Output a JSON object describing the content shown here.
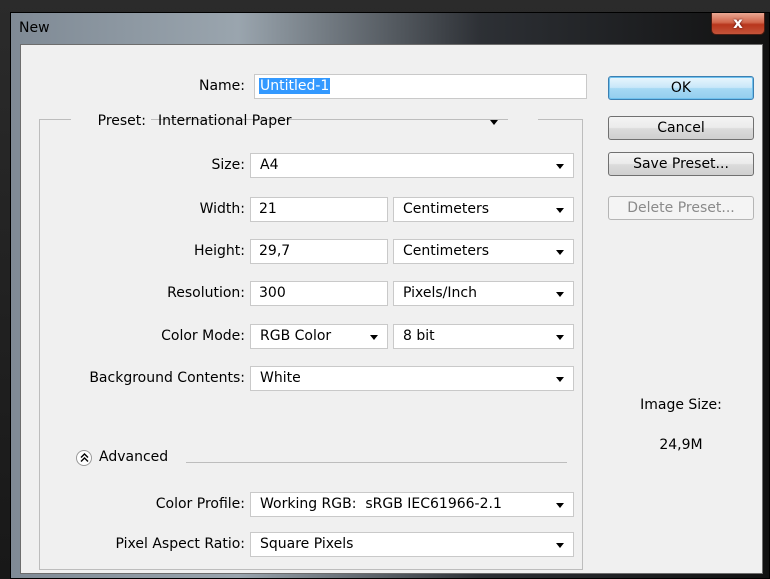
{
  "window": {
    "title": "New",
    "close_glyph": "x"
  },
  "form": {
    "name": {
      "label": "Name:",
      "value": "Untitled-1"
    },
    "preset": {
      "label": "Preset:",
      "value": "International Paper"
    },
    "size": {
      "label": "Size:",
      "value": "A4"
    },
    "width": {
      "label": "Width:",
      "value": "21",
      "unit": "Centimeters"
    },
    "height": {
      "label": "Height:",
      "value": "29,7",
      "unit": "Centimeters"
    },
    "resolution": {
      "label": "Resolution:",
      "value": "300",
      "unit": "Pixels/Inch"
    },
    "color_mode": {
      "label": "Color Mode:",
      "value": "RGB Color",
      "bit_depth": "8 bit"
    },
    "background": {
      "label": "Background Contents:",
      "value": "White"
    },
    "advanced": {
      "label": "Advanced",
      "icon": "chevron-up-double-icon"
    },
    "color_profile": {
      "label": "Color Profile:",
      "value": "Working RGB:  sRGB IEC61966-2.1"
    },
    "pixel_aspect": {
      "label": "Pixel Aspect Ratio:",
      "value": "Square Pixels"
    }
  },
  "buttons": {
    "ok": "OK",
    "cancel": "Cancel",
    "save_preset": "Save Preset...",
    "delete_preset": "Delete Preset..."
  },
  "image_size": {
    "label": "Image Size:",
    "value": "24,9M"
  },
  "colors": {
    "selection": "#3399ff",
    "dialog_bg": "#f0f0f0",
    "close_button": "#c4543a"
  }
}
